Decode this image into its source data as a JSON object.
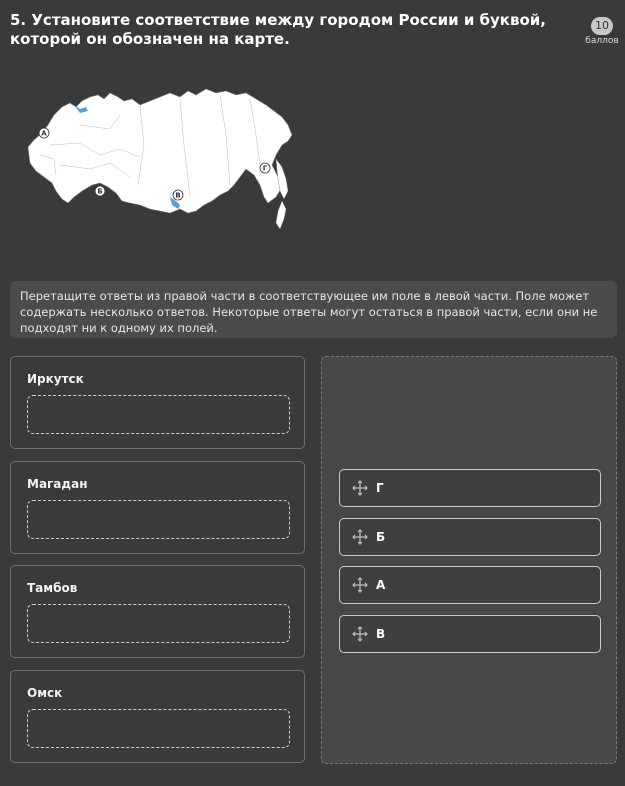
{
  "question": {
    "title": "5. Установите соответствие между городом России и буквой, которой он обозначен на карте.",
    "points_value": "10",
    "points_label": "баллов"
  },
  "map": {
    "letters": [
      "А",
      "Б",
      "В",
      "Г"
    ]
  },
  "instructions": "Перетащите ответы из правой части в соответствующее им поле в левой части. Поле может содержать несколько ответов. Некоторые ответы могут остаться в правой части, если они не подходят ни к одному их полей.",
  "targets": [
    {
      "label": "Иркутск"
    },
    {
      "label": "Магадан"
    },
    {
      "label": "Тамбов"
    },
    {
      "label": "Омск"
    }
  ],
  "answers": [
    {
      "label": "Г"
    },
    {
      "label": "Б"
    },
    {
      "label": "А"
    },
    {
      "label": "В"
    }
  ],
  "icons": {
    "drag": "move-arrows-icon"
  },
  "colors": {
    "background": "#3a3a3a",
    "hint_background": "#4b4b4d",
    "answer_pool_background": "#474747"
  }
}
